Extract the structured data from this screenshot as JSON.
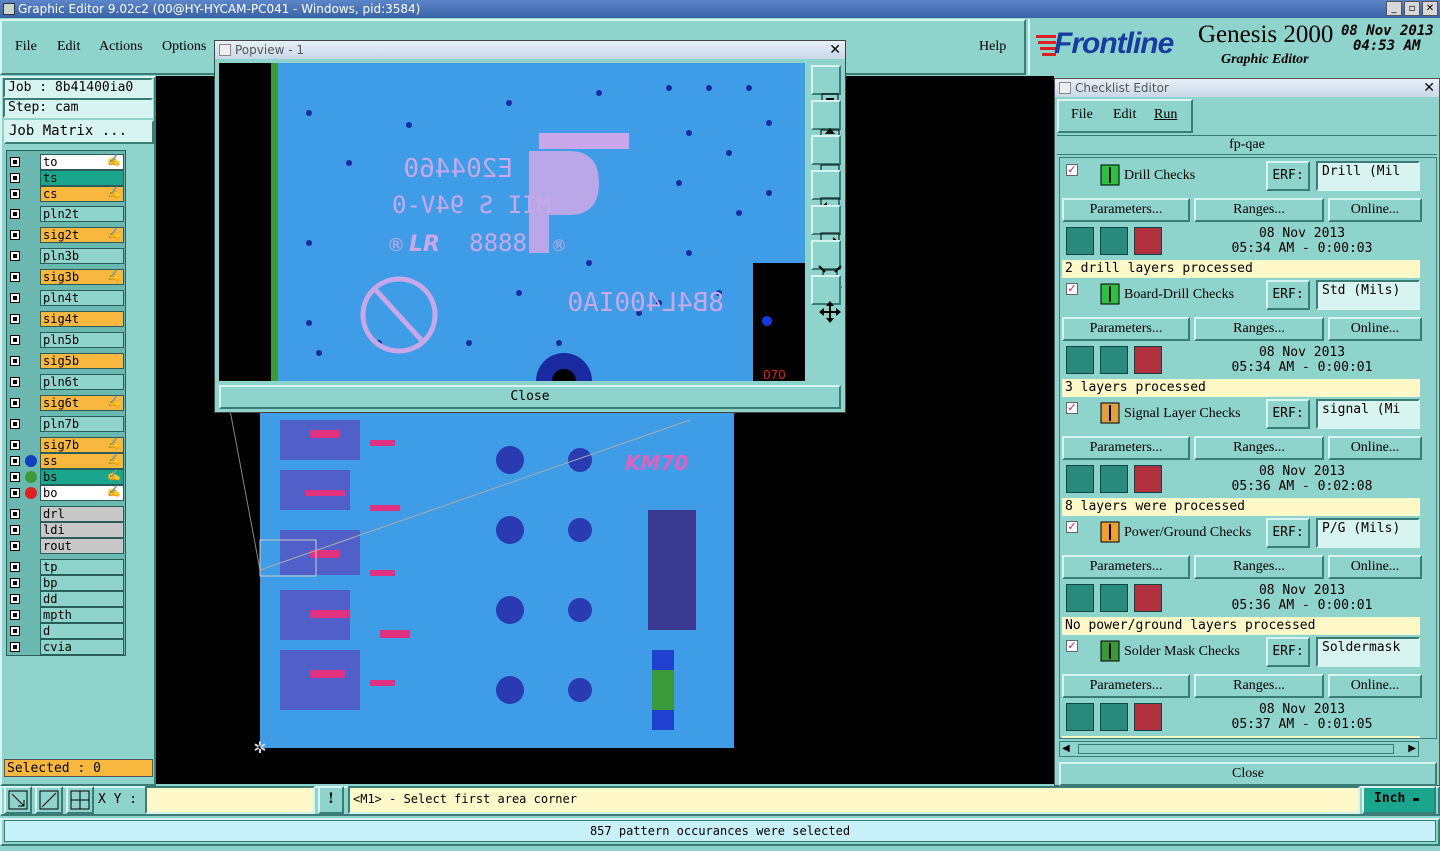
{
  "titlebar": {
    "title": "Graphic Editor 9.02c2 (00@HY-HYCAM-PC041 - Windows, pid:3584)"
  },
  "menu": {
    "file": "File",
    "edit": "Edit",
    "actions": "Actions",
    "options": "Options",
    "help": "Help"
  },
  "brand": {
    "logo": "Frontline",
    "product": "Genesis 2000",
    "subtitle": "Graphic Editor",
    "date": "08 Nov 2013",
    "time": "04:53 AM"
  },
  "job": {
    "job": "Job : 8b41400ia0",
    "step": "Step: cam",
    "matrix_btn": "Job Matrix ..."
  },
  "layers": [
    {
      "name": "to",
      "color": "#ffffff",
      "edit": true
    },
    {
      "name": "ts",
      "color": "#19a68c",
      "edit": false
    },
    {
      "name": "cs",
      "color": "#f8b840",
      "edit": true
    },
    {
      "name": "pln2t",
      "color": "#8fd4cc",
      "edit": false
    },
    {
      "name": "sig2t",
      "color": "#f8b840",
      "edit": true
    },
    {
      "name": "pln3b",
      "color": "#8fd4cc",
      "edit": false
    },
    {
      "name": "sig3b",
      "color": "#f8b840",
      "edit": true
    },
    {
      "name": "pln4t",
      "color": "#8fd4cc",
      "edit": false
    },
    {
      "name": "sig4t",
      "color": "#f8b840",
      "edit": false
    },
    {
      "name": "pln5b",
      "color": "#8fd4cc",
      "edit": false
    },
    {
      "name": "sig5b",
      "color": "#f8b840",
      "edit": false
    },
    {
      "name": "pln6t",
      "color": "#8fd4cc",
      "edit": false
    },
    {
      "name": "sig6t",
      "color": "#f8b840",
      "edit": true
    },
    {
      "name": "pln7b",
      "color": "#8fd4cc",
      "edit": false
    },
    {
      "name": "sig7b",
      "color": "#f8b840",
      "edit": true
    },
    {
      "name": "ss",
      "color": "#f8b840",
      "edit": true,
      "dot": "#1040c0"
    },
    {
      "name": "bs",
      "color": "#19a68c",
      "edit": true,
      "dot": "#3a9a3a"
    },
    {
      "name": "bo",
      "color": "#ffffff",
      "edit": true,
      "dot": "#e02020"
    },
    {
      "name": "drl",
      "color": "#c8c8c8",
      "edit": false
    },
    {
      "name": "ldi",
      "color": "#c8c8c8",
      "edit": false
    },
    {
      "name": "rout",
      "color": "#c8c8c8",
      "edit": false
    },
    {
      "name": "tp",
      "color": "#8fd4cc",
      "edit": false
    },
    {
      "name": "bp",
      "color": "#8fd4cc",
      "edit": false
    },
    {
      "name": "dd",
      "color": "#8fd4cc",
      "edit": false
    },
    {
      "name": "mpth",
      "color": "#8fd4cc",
      "edit": false
    },
    {
      "name": "d",
      "color": "#8fd4cc",
      "edit": false
    },
    {
      "name": "cvia",
      "color": "#8fd4cc",
      "edit": false
    }
  ],
  "selected": "Selected : 0",
  "popview": {
    "title": "Popview - 1",
    "close": "Close",
    "board_text": [
      "E204460",
      "MII S 94V-0",
      "8888",
      "8B4L400IA0"
    ]
  },
  "checklist": {
    "title": "Checklist Editor",
    "menu": {
      "file": "File",
      "edit": "Edit",
      "run": "Run"
    },
    "name": "fp-qae",
    "erf_label": "ERF:",
    "params_label": "Parameters...",
    "ranges_label": "Ranges...",
    "online_label": "Online...",
    "sections": [
      {
        "name": "Drill Checks",
        "erf": "Drill (Mil",
        "date": "08 Nov 2013",
        "time": "05:34 AM - 0:00:03",
        "msg": "2 drill layers processed",
        "icon_color": "#2ec040"
      },
      {
        "name": "Board-Drill Checks",
        "erf": "Std (Mils)",
        "date": "08 Nov 2013",
        "time": "05:34 AM - 0:00:01",
        "msg": "3 layers processed",
        "icon_color": "#2ec040"
      },
      {
        "name": "Signal Layer Checks",
        "erf": "signal (Mi",
        "date": "08 Nov 2013",
        "time": "05:36 AM - 0:02:08",
        "msg": "8 layers were processed",
        "icon_color": "#e0a040"
      },
      {
        "name": "Power/Ground Checks",
        "erf": "P/G (Mils)",
        "date": "08 Nov 2013",
        "time": "05:36 AM - 0:00:01",
        "msg": "No power/ground layers processed",
        "icon_color": "#f0a030"
      },
      {
        "name": "Solder Mask Checks",
        "erf": "Soldermask",
        "date": "08 Nov 2013",
        "time": "05:37 AM - 0:01:05",
        "msg": "",
        "icon_color": "#3a9a3a"
      }
    ],
    "close": "Close"
  },
  "bottombar": {
    "xy_label": "X Y :",
    "xy_value": "",
    "prompt": "<M1> - Select first area corner",
    "units": "Inch"
  },
  "status": "857 pattern occurances were selected"
}
